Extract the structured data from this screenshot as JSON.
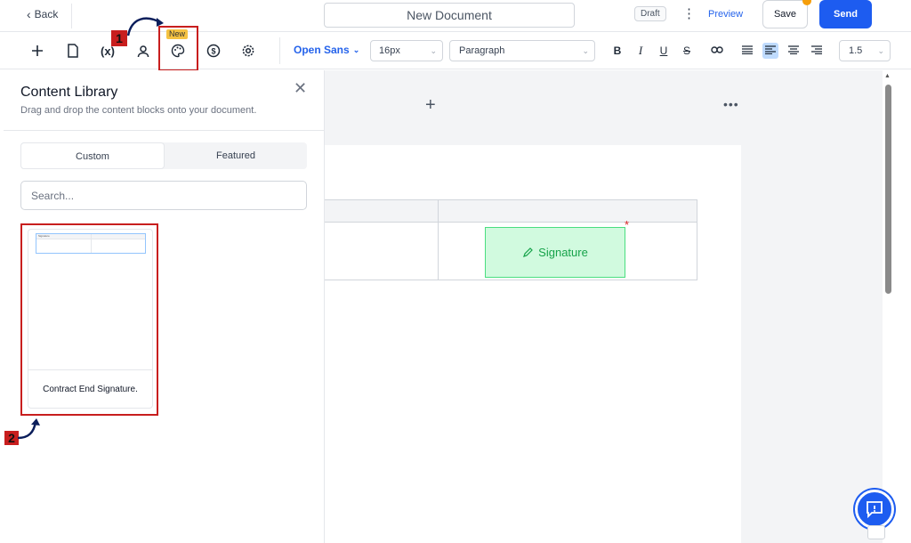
{
  "header": {
    "back_label": "Back",
    "document_title": "New Document",
    "status_badge": "Draft",
    "preview_label": "Preview",
    "save_label": "Save",
    "send_label": "Send"
  },
  "toolbar": {
    "variable_icon_label": "(x)",
    "new_badge": "New",
    "font_family": "Open Sans",
    "font_size": "16px",
    "block_style": "Paragraph",
    "format_buttons": {
      "bold": "B",
      "italic": "I",
      "underline": "U",
      "strike": "S"
    },
    "line_spacing": "1.5"
  },
  "annotations": {
    "step1": "1",
    "step2": "2"
  },
  "content_library": {
    "title": "Content Library",
    "subtitle": "Drag and drop the content blocks onto your document.",
    "tabs": [
      {
        "label": "Custom",
        "active": true
      },
      {
        "label": "Featured",
        "active": false
      }
    ],
    "search_placeholder": "Search...",
    "blocks": [
      {
        "label": "Contract End Signature.",
        "preview_label": "Signature"
      }
    ]
  },
  "canvas": {
    "signature_field_label": "Signature",
    "required_marker": "*"
  },
  "colors": {
    "primary": "#1d5cf0",
    "highlight": "#c81e1e",
    "signature_bg": "#d1fadf",
    "signature_text": "#16a34a"
  }
}
